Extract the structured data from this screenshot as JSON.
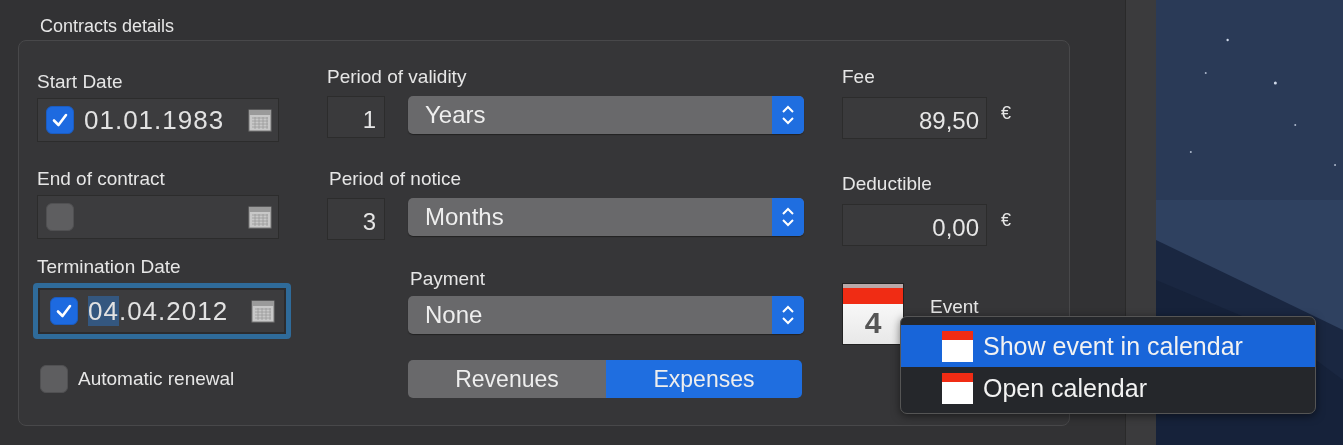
{
  "section": {
    "title": "Contracts details"
  },
  "dates": [
    {
      "label": "Start Date",
      "checked": true,
      "focused": false,
      "segments": [
        {
          "text": "01.01.1983",
          "selected": false
        }
      ]
    },
    {
      "label": "End of contract",
      "checked": false,
      "focused": false
    },
    {
      "label": "Termination Date",
      "checked": true,
      "focused": true,
      "segments": [
        {
          "text": "04",
          "selected": true
        },
        {
          "text": ".04.2012",
          "selected": false
        }
      ]
    }
  ],
  "automatic_renewal": {
    "label": "Automatic renewal",
    "checked": false
  },
  "periods": [
    {
      "label": "Period of validity",
      "count": "1",
      "unit": "Years"
    },
    {
      "label": "Period of notice",
      "count": "3",
      "unit": "Months"
    }
  ],
  "payment": {
    "label": "Payment",
    "value": "None"
  },
  "type_toggle": [
    {
      "label": "Revenues",
      "selected": false
    },
    {
      "label": "Expenses",
      "selected": true
    }
  ],
  "amounts": [
    {
      "label": "Fee",
      "value": "89,50",
      "currency": "€"
    },
    {
      "label": "Deductible",
      "value": "0,00",
      "currency": "€"
    }
  ],
  "event": {
    "day": "4",
    "label": "Event"
  },
  "context_menu": [
    {
      "label": "Show event in calendar",
      "selected": true
    },
    {
      "label": "Open calendar",
      "selected": false
    }
  ]
}
